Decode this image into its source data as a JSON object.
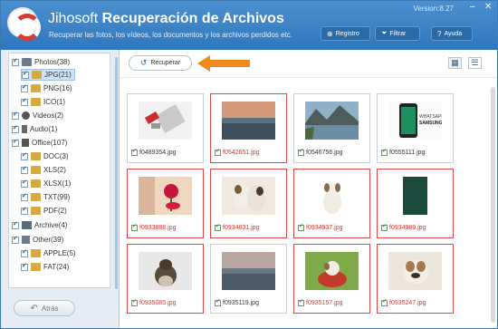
{
  "header": {
    "brand": "Jihosoft",
    "product": "Recuperación de Archivos",
    "subtitle": "Recuperar las fotos, los vídeos, los documentos y los archivos perdidos etc.",
    "version": "Version:8.27",
    "buttons": [
      {
        "label": "Registro",
        "icon": "register-icon"
      },
      {
        "label": "Filtrar",
        "icon": "filter-icon"
      },
      {
        "label": "Ayuda",
        "icon": "help-icon"
      }
    ],
    "window_controls": {
      "minimize": "–",
      "close": "✕"
    }
  },
  "sidebar": {
    "tree": [
      {
        "label": "Photos(38)",
        "icon": "photo-icon",
        "level": 0
      },
      {
        "label": "JPG(21)",
        "icon": "folder-icon",
        "level": 1,
        "selected": true
      },
      {
        "label": "PNG(16)",
        "icon": "folder-icon",
        "level": 1
      },
      {
        "label": "ICO(1)",
        "icon": "folder-icon",
        "level": 1
      },
      {
        "label": "Videos(2)",
        "icon": "video-icon",
        "level": 0
      },
      {
        "label": "Audio(1)",
        "icon": "audio-icon",
        "level": 0
      },
      {
        "label": "Office(107)",
        "icon": "office-icon",
        "level": 0
      },
      {
        "label": "DOC(3)",
        "icon": "folder-icon",
        "level": 1
      },
      {
        "label": "XLS(2)",
        "icon": "folder-icon",
        "level": 1
      },
      {
        "label": "XLSX(1)",
        "icon": "folder-icon",
        "level": 1
      },
      {
        "label": "TXT(99)",
        "icon": "folder-icon",
        "level": 1
      },
      {
        "label": "PDF(2)",
        "icon": "folder-icon",
        "level": 1
      },
      {
        "label": "Archive(4)",
        "icon": "archive-icon",
        "level": 0
      },
      {
        "label": "Other(39)",
        "icon": "other-icon",
        "level": 0
      },
      {
        "label": "APPLE(5)",
        "icon": "folder-icon",
        "level": 1
      },
      {
        "label": "FAT(24)",
        "icon": "folder-icon",
        "level": 1
      }
    ],
    "back_label": "Atrás"
  },
  "toolbar": {
    "recover_label": "Recuperar",
    "grid_view_icon": "grid-view-icon",
    "list_view_icon": "list-view-icon"
  },
  "files": [
    {
      "name": "f0489354.jpg",
      "selected": false,
      "img": "usb-drive"
    },
    {
      "name": "f0542651.jpg",
      "selected": true,
      "img": "lake-sunset"
    },
    {
      "name": "f0546756.jpg",
      "selected": false,
      "img": "mountain-lake"
    },
    {
      "name": "f0555111.jpg",
      "selected": false,
      "img": "whatsapp-phone"
    },
    {
      "name": "f0933888.jpg",
      "selected": true,
      "img": "red-rose"
    },
    {
      "name": "f0934831.jpg",
      "selected": true,
      "img": "puppies"
    },
    {
      "name": "f0934937.jpg",
      "selected": true,
      "img": "puppy-sitting"
    },
    {
      "name": "f0934989.jpg",
      "selected": true,
      "img": "green-board"
    },
    {
      "name": "f0935085.jpg",
      "selected": true,
      "img": "puppy-back"
    },
    {
      "name": "f0935119.jpg",
      "selected": false,
      "img": "lake-dusk"
    },
    {
      "name": "f0935157.jpg",
      "selected": true,
      "img": "puppy-basket"
    },
    {
      "name": "f0935247.jpg",
      "selected": true,
      "img": "bulldog"
    }
  ],
  "colors": {
    "header": "#3a82c6",
    "selected_border": "#e04848",
    "accent_arrow": "#f08a1c"
  }
}
